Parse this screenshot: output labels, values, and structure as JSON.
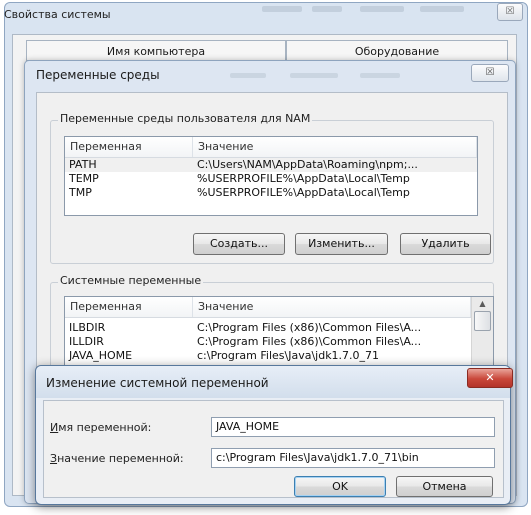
{
  "system_properties": {
    "title": "Свойства системы",
    "close_glyph": "☒",
    "tabs": [
      "Имя компьютера",
      "Оборудование"
    ]
  },
  "env_dialog": {
    "title": "Переменные среды",
    "close_glyph": "☒",
    "user_group_label": "Переменные среды пользователя для NAM",
    "columns": [
      "Переменная",
      "Значение"
    ],
    "user_vars": [
      {
        "name": "PATH",
        "value": "C:\\Users\\NAM\\AppData\\Roaming\\npm;..."
      },
      {
        "name": "TEMP",
        "value": "%USERPROFILE%\\AppData\\Local\\Temp"
      },
      {
        "name": "TMP",
        "value": "%USERPROFILE%\\AppData\\Local\\Temp"
      }
    ],
    "user_buttons": {
      "create": "Создать...",
      "edit": "Изменить...",
      "delete": "Удалить"
    },
    "system_group_label": "Системные переменные",
    "system_vars": [
      {
        "name": "ILBDIR",
        "value": "C:\\Program Files (x86)\\Common Files\\A..."
      },
      {
        "name": "ILLDIR",
        "value": "C:\\Program Files (x86)\\Common Files\\A..."
      },
      {
        "name": "JAVA_HOME",
        "value": "c:\\Program Files\\Java\\jdk1.7.0_71"
      }
    ]
  },
  "edit_dialog": {
    "title": "Изменение системной переменной",
    "close_glyph": "✕",
    "name_label_accel": "И",
    "name_label_rest": "мя переменной:",
    "name_value": "JAVA_HOME",
    "value_label_accel": "З",
    "value_label_rest": "начение переменной:",
    "value_value": "c:\\Program Files\\Java\\jdk1.7.0_71\\bin",
    "ok_label": "OK",
    "cancel_label": "Отмена"
  },
  "colors": {
    "frame": "#d9e4f1",
    "close_red": "#c9473a",
    "selected_row": "#f0f0f0"
  },
  "icons": {
    "scroll_up": "▲"
  }
}
